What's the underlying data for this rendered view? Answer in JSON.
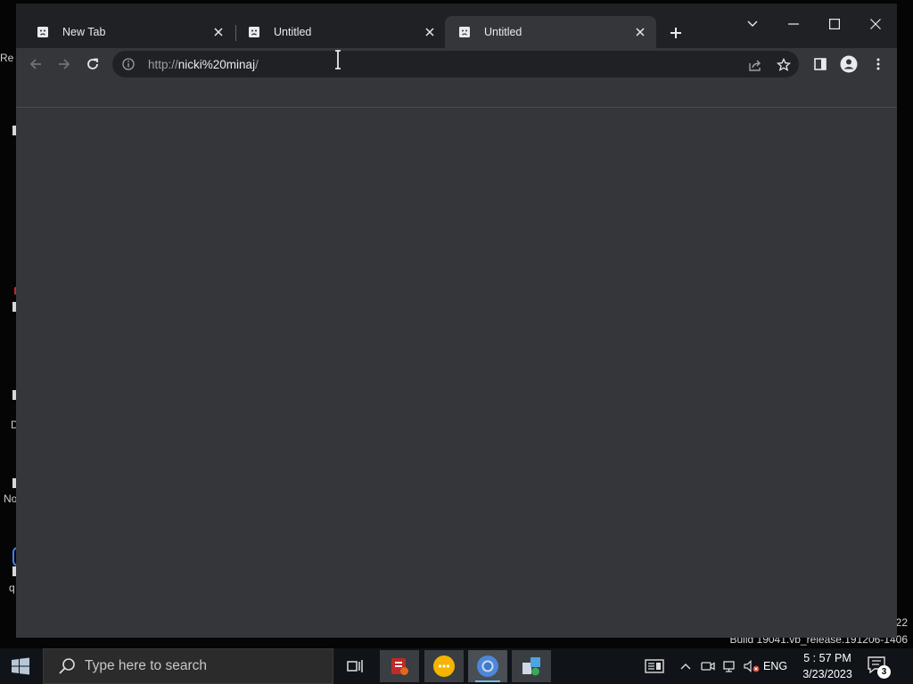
{
  "browser": {
    "tabs": [
      {
        "title": "New Tab",
        "active": false
      },
      {
        "title": "Untitled",
        "active": false
      },
      {
        "title": "Untitled",
        "active": true
      }
    ],
    "address": {
      "scheme": "http://",
      "host": "nicki%20minaj",
      "path": "/"
    },
    "colors": {
      "frame": "#202124",
      "toolbar": "#35363a",
      "omnibox": "#202124"
    }
  },
  "desktop": {
    "fragments": [
      "Re",
      "D",
      "No",
      "q"
    ],
    "watermark_version": "22",
    "watermark_build": "Build 19041.vb_release.191206-1406"
  },
  "taskbar": {
    "search_placeholder": "Type here to search",
    "language": "ENG",
    "time": "5 : 57 PM",
    "date": "3/23/2023",
    "notification_count": "3",
    "accent": "#76b9ed"
  }
}
